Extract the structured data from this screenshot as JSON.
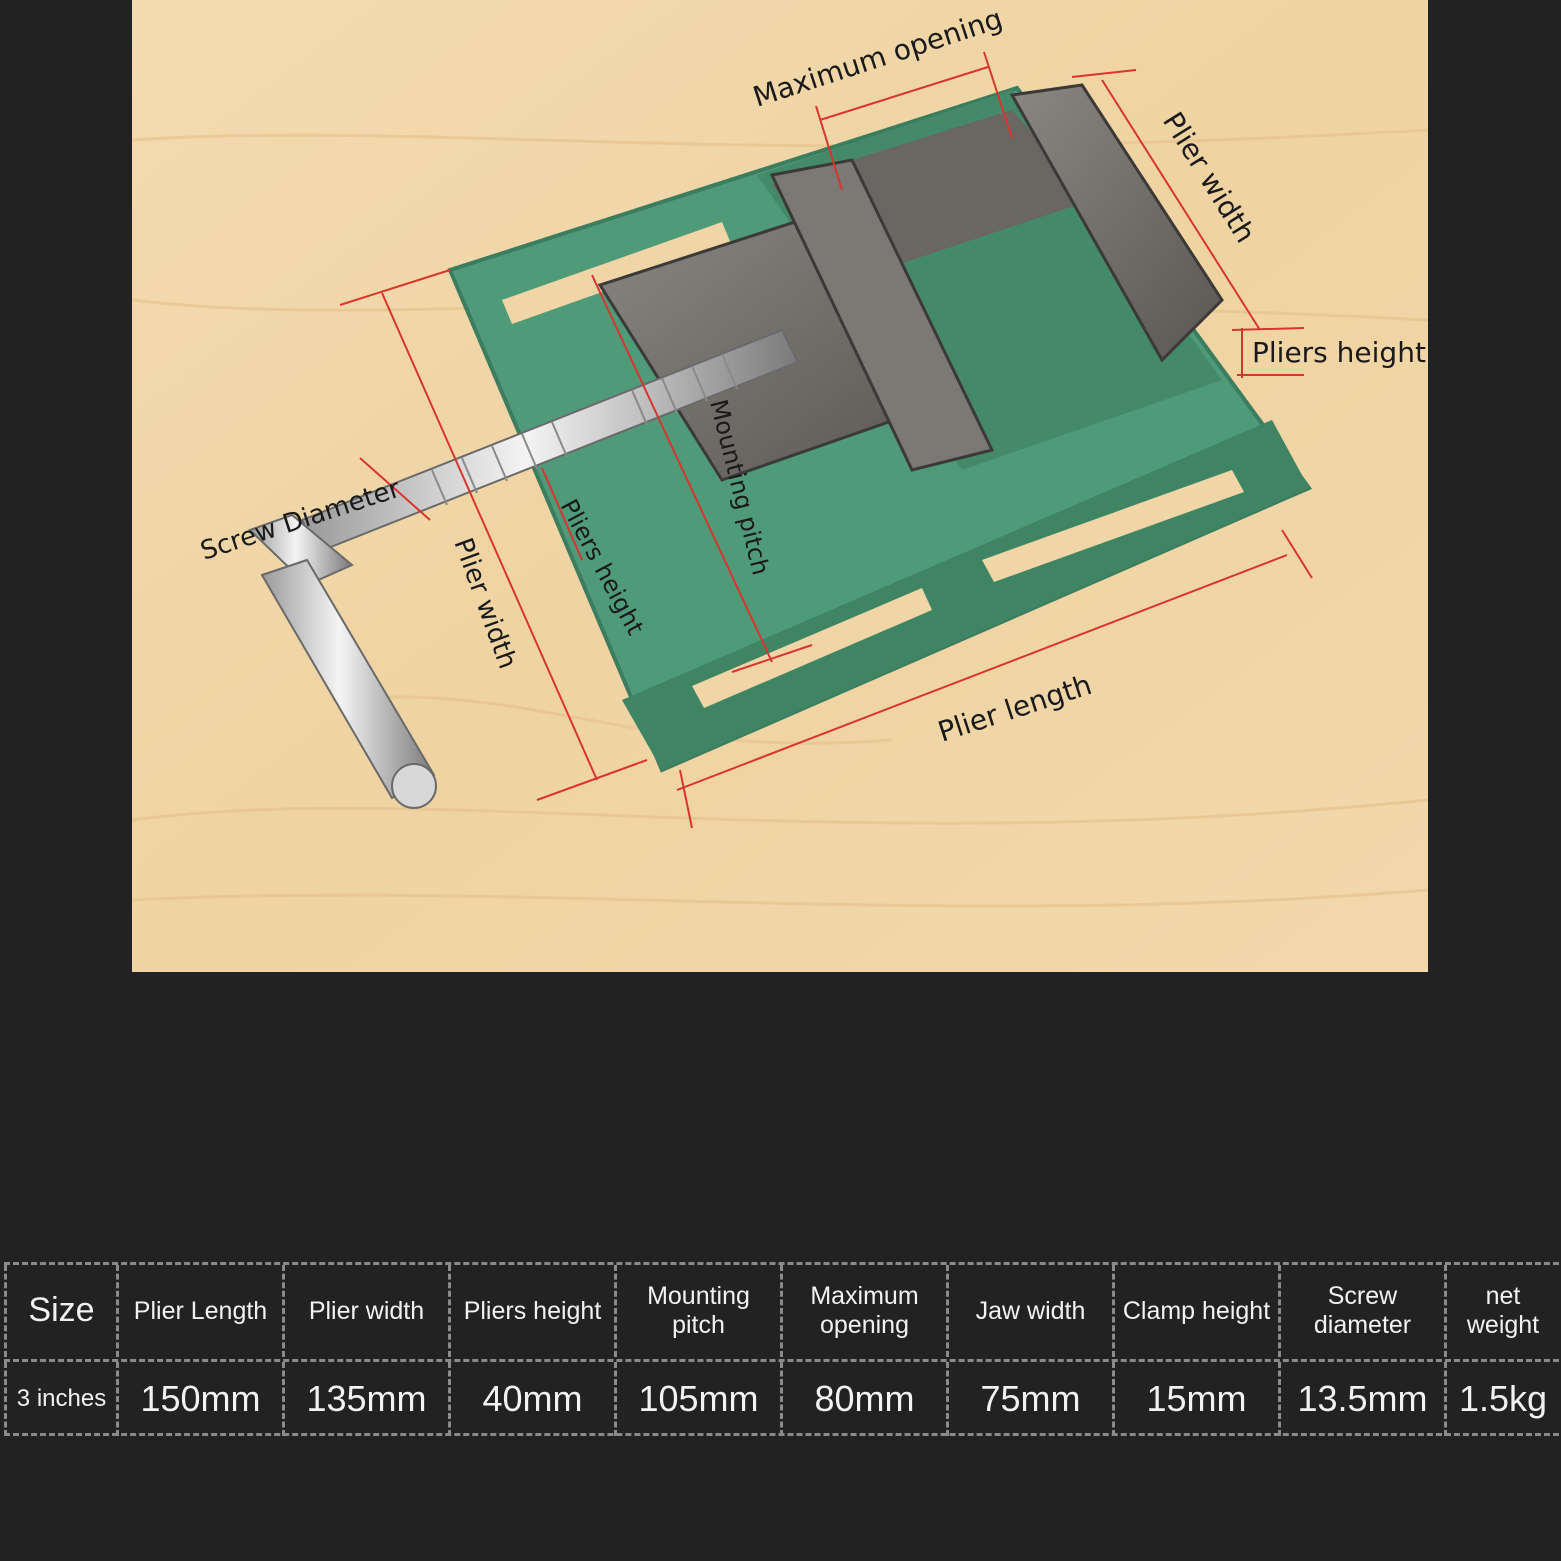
{
  "colors": {
    "background": "#222222",
    "wood": "#f0d5a6",
    "vise_green": "#4f9a78",
    "jaw_steel": "#6e6a66",
    "dimension_line": "#d8352f",
    "table_text": "#f2f2f2",
    "table_border": "#8a8a8a"
  },
  "photo": {
    "labels": {
      "maximum_opening": "Maximum opening",
      "plier_width_top": "Plier width",
      "pliers_height_right": "Pliers height",
      "screw_diameter": "Screw Diameter",
      "plier_width_left": "Plier width",
      "pliers_height_mid": "Pliers height",
      "mounting_pitch": "Mounting pitch",
      "plier_length": "Plier length"
    }
  },
  "specs": {
    "headers": [
      "Size",
      "Plier Length",
      "Plier width",
      "Pliers height",
      "Mounting\npitch",
      "Maximum\nopening",
      "Jaw width",
      "Clamp height",
      "Screw\ndiameter",
      "net\nweight"
    ],
    "values": [
      "3 inches",
      "150mm",
      "135mm",
      "40mm",
      "105mm",
      "80mm",
      "75mm",
      "15mm",
      "13.5mm",
      "1.5kg"
    ]
  }
}
